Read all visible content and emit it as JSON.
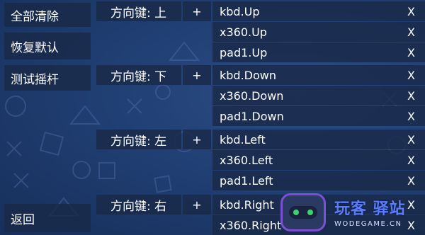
{
  "sidebar": {
    "clear_all": "全部清除",
    "restore_default": "恢复默认",
    "test_joystick": "测试摇杆",
    "back": "返回"
  },
  "mappings": [
    {
      "label": "方向键: 上",
      "add": "+",
      "bindings": [
        "kbd.Up",
        "x360.Up",
        "pad1.Up"
      ]
    },
    {
      "label": "方向键: 下",
      "add": "+",
      "bindings": [
        "kbd.Down",
        "x360.Down",
        "pad1.Down"
      ]
    },
    {
      "label": "方向键: 左",
      "add": "+",
      "bindings": [
        "kbd.Left",
        "x360.Left",
        "pad1.Left"
      ]
    },
    {
      "label": "方向键: 右",
      "add": "+",
      "bindings": [
        "kbd.Right",
        "x360.Right"
      ]
    }
  ],
  "remove_symbol": "X",
  "watermark": {
    "title": "玩客 驿站",
    "subtitle": "WODEGAME.CN"
  },
  "colors": {
    "background": "#203f73",
    "panel": "#1a2948",
    "watermark_accent": "#5b7cff"
  }
}
